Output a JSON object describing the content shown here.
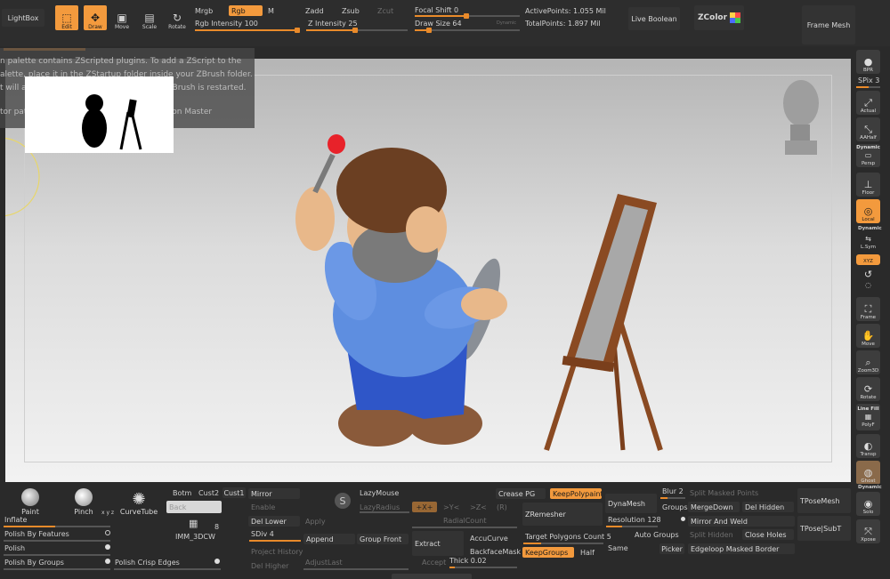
{
  "topbar": {
    "lightbox": "LightBox",
    "tools": [
      {
        "label": "Edit",
        "icon": "edit-icon",
        "active": true
      },
      {
        "label": "Draw",
        "icon": "draw-icon",
        "active": true
      },
      {
        "label": "Move",
        "icon": "move-icon",
        "active": false
      },
      {
        "label": "Scale",
        "icon": "scale-icon",
        "active": false
      },
      {
        "label": "Rotate",
        "icon": "rotate-icon",
        "active": false
      }
    ],
    "mrgb": "Mrgb",
    "rgb": "Rgb",
    "m": "M",
    "rgb_intensity_label": "Rgb Intensity",
    "rgb_intensity_value": "100",
    "zadd": "Zadd",
    "zsub": "Zsub",
    "zcut": "Zcut",
    "z_intensity_label": "Z Intensity",
    "z_intensity_value": "25",
    "focal_shift_label": "Focal Shift",
    "focal_shift_value": "0",
    "draw_size_label": "Draw Size",
    "draw_size_value": "64",
    "dynamic": "Dynamic",
    "active_points": "ActivePoints: 1.055 Mil",
    "total_points": "TotalPoints: 1.897 Mil",
    "live_boolean": "Live Boolean",
    "zcolor": "ZColor",
    "frame_mesh": "Frame Mesh"
  },
  "notification": {
    "lines": [
      "n palette contains ZScripted plugins. To add a ZScript to the",
      "alette, place it in the ZStartup folder inside your ZBrush folder.",
      "t will appear in this palette the next time ZBrush is restarted.",
      "",
      "tor path: Zplugin:Projection Master:Projection Master"
    ]
  },
  "right_shelf": {
    "bpr": "BPR",
    "spix_label": "SPix",
    "spix_value": "3",
    "actual": "Actual",
    "aahalf": "AAHalf",
    "dynamic": "Dynamic",
    "persp": "Persp",
    "floor": "Floor",
    "local": "Local",
    "dynamic2": "Dynamic",
    "lsym": "L.Sym",
    "xyz": "XYZ",
    "frame": "Frame",
    "move": "Move",
    "zoom3d": "Zoom3D",
    "rotate": "Rotate",
    "line_fill": "Line Fill",
    "polyf": "PolyF",
    "transp": "Transp",
    "ghost": "Ghost",
    "dynamic3": "Dynamic",
    "solo": "Solo",
    "xpose": "Xpose"
  },
  "bottom": {
    "paint": "Paint",
    "pinch": "Pinch",
    "curvetube": "CurveTube",
    "botm": "Botm",
    "cust2": "Cust2",
    "cust1": "Cust1",
    "back": "Back",
    "imm_count": "8",
    "imm_3dcw": "IMM_3DCW",
    "inflate": "Inflate",
    "polish_by_features": "Polish By Features",
    "polish": "Polish",
    "polish_by_groups": "Polish By Groups",
    "polish_crisp_edges": "Polish Crisp Edges",
    "mirror": "Mirror",
    "enable": "Enable",
    "del_lower": "Del Lower",
    "apply": "Apply",
    "sdiv_label": "SDiv",
    "sdiv_value": "4",
    "append": "Append",
    "group_front": "Group Front",
    "project_history": "Project History",
    "del_higher": "Del Higher",
    "adjust_last": "AdjustLast",
    "lazymouse": "LazyMouse",
    "lazyradius": "LazyRadius",
    "sym_x": "+X+",
    "sym_y": ">Y<",
    "sym_z": ">Z<",
    "sym_r": "(R)",
    "radial_count": "RadialCount",
    "extract": "Extract",
    "accucurve": "AccuCurve",
    "backface_mask": "BackfaceMask",
    "accept": "Accept",
    "thick_label": "Thick",
    "thick_value": "0.02",
    "crease_pg": "Crease PG",
    "keep_polypaint": "KeepPolypaint",
    "zremesher": "ZRemesher",
    "target_polygons_label": "Target Polygons Count",
    "target_polygons_value": "5",
    "keep_groups": "KeepGroups",
    "half": "Half",
    "dynamesh": "DynaMesh",
    "resolution_label": "Resolution",
    "resolution_value": "128",
    "auto_groups": "Auto Groups",
    "same": "Same",
    "blur_label": "Blur",
    "blur_value": "2",
    "groups": "Groups",
    "picker": "Picker",
    "split_masked_points": "Split Masked Points",
    "merge_down": "MergeDown",
    "del_hidden": "Del Hidden",
    "mirror_and_weld": "Mirror And Weld",
    "split_hidden": "Split Hidden",
    "close_holes": "Close Holes",
    "edgeloop_masked_border": "Edgeloop Masked Border",
    "tposemesh": "TPoseMesh",
    "tpose_subt": "TPose|SubT"
  },
  "colors": {
    "accent": "#f39a3d",
    "panel": "#2a2a2a",
    "button": "#3c3c3c"
  }
}
